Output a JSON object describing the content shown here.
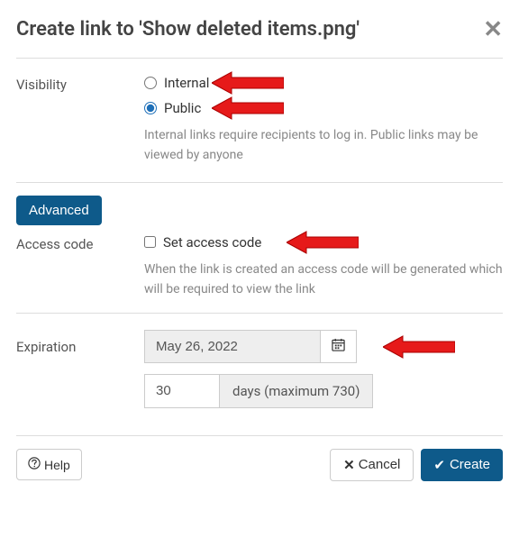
{
  "dialog": {
    "title": "Create link to 'Show deleted items.png'"
  },
  "visibility": {
    "label": "Visibility",
    "internal_label": "Internal",
    "public_label": "Public",
    "help": "Internal links require recipients to log in. Public links may be viewed by anyone"
  },
  "advanced": {
    "button_label": "Advanced"
  },
  "access_code": {
    "label": "Access code",
    "checkbox_label": "Set access code",
    "help": "When the link is created an access code will be generated which will be required to view the link"
  },
  "expiration": {
    "label": "Expiration",
    "date_value": "May 26, 2022",
    "days_value": "30",
    "days_label": "days (maximum 730)"
  },
  "footer": {
    "help_label": "Help",
    "cancel_label": "Cancel",
    "create_label": "Create"
  }
}
